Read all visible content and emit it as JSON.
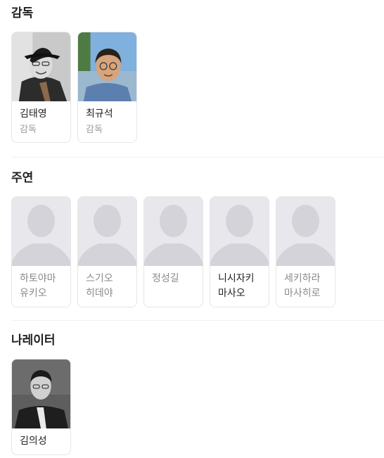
{
  "directors": {
    "title": "감독",
    "people": [
      {
        "name": "김태영",
        "role": "감독"
      },
      {
        "name": "최규석",
        "role": "감독"
      }
    ]
  },
  "cast": {
    "title": "주연",
    "people": [
      {
        "name": "하토야마 유키오"
      },
      {
        "name": "스기오 히데야"
      },
      {
        "name": "정성길"
      },
      {
        "name": "니시자키 마사오"
      },
      {
        "name": "세키하라 마사히로"
      }
    ]
  },
  "narrator": {
    "title": "나레이터",
    "people": [
      {
        "name": "김의성"
      }
    ]
  },
  "colors": {
    "placeholder_bg": "#e8e8ec",
    "placeholder_silhouette": "#d3d3d9",
    "card_border": "#e6e6ea"
  }
}
